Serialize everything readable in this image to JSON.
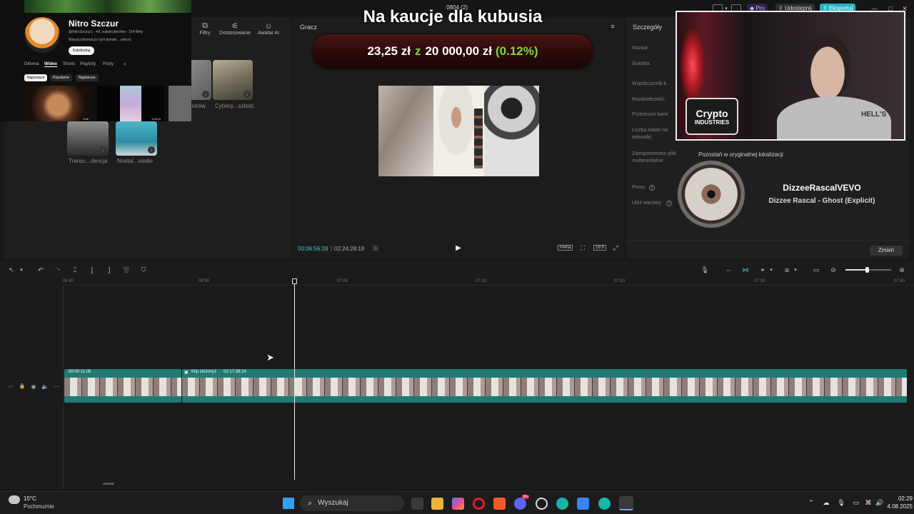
{
  "project": {
    "title": "0804 (2)"
  },
  "topbar": {
    "pro_label": "Pro",
    "share_label": "Udostępnij",
    "export_label": "Eksportuj"
  },
  "overlay": {
    "headline": "Na kaucje dla kubusia",
    "donation_raised": "23,25 zł",
    "donation_sep": "z",
    "donation_goal": "20 000,00 zł",
    "donation_pct": "(0.12%)"
  },
  "channel": {
    "name": "Nitro Szczur",
    "meta": "@NitroSzczur1 · 4/1 subskrybentów · 154 filmy",
    "desc": "Więcej informacji o tym kanale ...więcej",
    "subscribe": "Subskrybuj",
    "tabs": [
      "Główna",
      "Wideo",
      "Shorts",
      "Playlisty",
      "Posty"
    ],
    "filters": [
      "Najnowsze",
      "Popularne",
      "Najstarsze"
    ],
    "durations": [
      "3:56",
      "1:29:11"
    ]
  },
  "media_toolbar": {
    "filters": "Filtry",
    "adjust": "Dostosowanie",
    "avatar": "Awatar AI"
  },
  "media_items": [
    {
      "label": "...iorów"
    },
    {
      "label": "Cyberp...szłość"
    },
    {
      "label": "Transc...dencja"
    },
    {
      "label": "Nostal...wiatło"
    }
  ],
  "player": {
    "title": "Gracz",
    "time_current": "00:06:56:28",
    "time_total": "02:24:28:18",
    "quality": "Pełna",
    "ratio": "16:9"
  },
  "details": {
    "title": "Szczegóły",
    "labels": [
      "Nazwa:",
      "Ścieżka:",
      "Współczynnik k...",
      "Rozdzielczość:",
      "Przestrzeń barw",
      "Liczba klatek na sekundę:",
      "Zaimportowane pliki multimedialne:",
      "Proxy:",
      "Ułóż warstwy"
    ],
    "import_value": "Pozostań w oryginalnej lokalizacji",
    "change_button": "Zmień"
  },
  "music": {
    "artist": "DizzeeRascalVEVO",
    "track": "Dizzee Rascal - Ghost (Explicit)"
  },
  "webcam": {
    "sign_line1": "Crypto",
    "sign_line2": "INDUSTRIES",
    "shirt_text": "HELL'S"
  },
  "ruler": {
    "ticks": [
      "06:40",
      "06:50",
      "07:00",
      "07:10",
      "07:20",
      "07:30",
      "07:40"
    ]
  },
  "timeline": {
    "clip1_time": "00:00:11:05",
    "clip2_name": "Klip złożony1",
    "clip2_time": "02:17:39:24"
  },
  "taskbar": {
    "temperature": "15°C",
    "weather": "Pochmurnie",
    "search_placeholder": "Wyszukaj",
    "time": "02:29",
    "date": "4.08.2025",
    "badge": "99+"
  },
  "colors": {
    "accent": "#3fc8cf",
    "donation_green": "#7bdc3c",
    "clip": "#1f7a74"
  }
}
